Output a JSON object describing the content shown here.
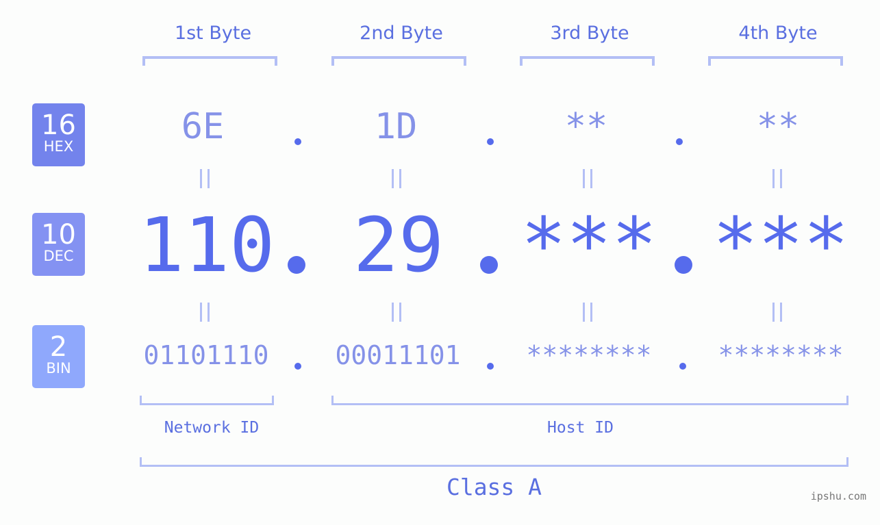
{
  "bytes": {
    "labels": [
      "1st Byte",
      "2nd Byte",
      "3rd Byte",
      "4th Byte"
    ]
  },
  "badges": {
    "hex": {
      "num": "16",
      "label": "HEX",
      "color": "#7383ec"
    },
    "dec": {
      "num": "10",
      "label": "DEC",
      "color": "#8492f2"
    },
    "bin": {
      "num": "2",
      "label": "BIN",
      "color": "#8fa8fc"
    }
  },
  "hex": [
    "6E",
    "1D",
    "**",
    "**"
  ],
  "dec": [
    "110",
    "29",
    "***",
    "***"
  ],
  "bin": [
    "01101110",
    "00011101",
    "********",
    "********"
  ],
  "ids": {
    "network": "Network ID",
    "host": "Host ID"
  },
  "class_label": "Class A",
  "watermark": "ipshu.com",
  "colors": {
    "accent": "#566bec",
    "bracket": "#b3bff5",
    "label": "#5a6fe0"
  }
}
